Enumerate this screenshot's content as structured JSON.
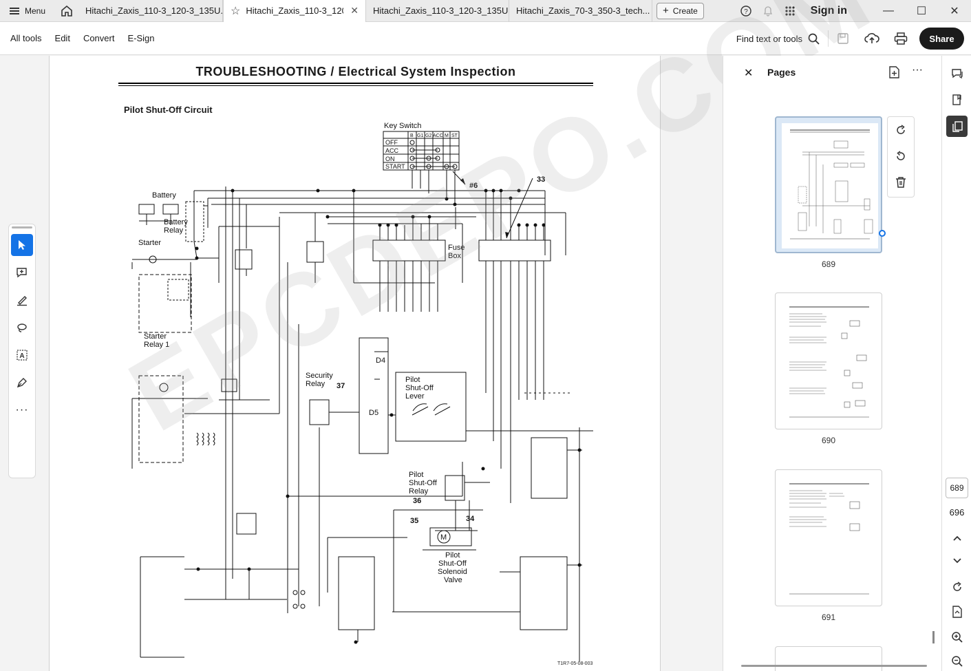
{
  "tabbar": {
    "menu_label": "Menu",
    "tabs": [
      {
        "label": "Hitachi_Zaxis_110-3_120-3_135U..."
      },
      {
        "label": "Hitachi_Zaxis_110-3_120...",
        "active": true
      },
      {
        "label": "Hitachi_Zaxis_110-3_120-3_135U..."
      },
      {
        "label": "Hitachi_Zaxis_70-3_350-3_tech..."
      }
    ],
    "create_label": "Create",
    "sign_in_label": "Sign in"
  },
  "toolbar": {
    "menu": [
      "All tools",
      "Edit",
      "Convert",
      "E-Sign"
    ],
    "find_label": "Find text or tools",
    "share_label": "Share"
  },
  "document": {
    "title": "TROUBLESHOOTING / Electrical System Inspection",
    "circuit_title": "Pilot Shut-Off Circuit",
    "doc_id": "T1R7-05-08-003",
    "watermark": "EPCDEPO.COM",
    "diagram_labels": {
      "key_switch": "Key Switch",
      "ks_cols": [
        "B",
        "G1",
        "G2",
        "ACC",
        "M",
        "ST"
      ],
      "ks_rows": [
        "OFF",
        "ACC",
        "ON",
        "START"
      ],
      "battery": "Battery",
      "battery_relay_1": "Battery",
      "battery_relay_2": "Relay",
      "starter": "Starter",
      "starter_relay_1": "Starter",
      "starter_relay_2": "Relay 1",
      "fuse_box_1": "Fuse",
      "fuse_box_2": "Box",
      "security_relay_1": "Security",
      "security_relay_2": "Relay",
      "psl_1": "Pilot",
      "psl_2": "Shut-Off",
      "psl_3": "Lever",
      "psr_1": "Pilot",
      "psr_2": "Shut-Off",
      "psr_3": "Relay",
      "psv_1": "Pilot",
      "psv_2": "Shut-Off",
      "psv_3": "Solenoid",
      "psv_4": "Valve",
      "d4": "D4",
      "d5": "D5",
      "motor": "M",
      "callouts": [
        "#6",
        "33",
        "37",
        "36",
        "34",
        "35"
      ]
    }
  },
  "panel": {
    "title": "Pages",
    "pages": [
      "689",
      "690",
      "691"
    ]
  },
  "rail": {
    "current_page": "689",
    "total_pages": "696"
  }
}
